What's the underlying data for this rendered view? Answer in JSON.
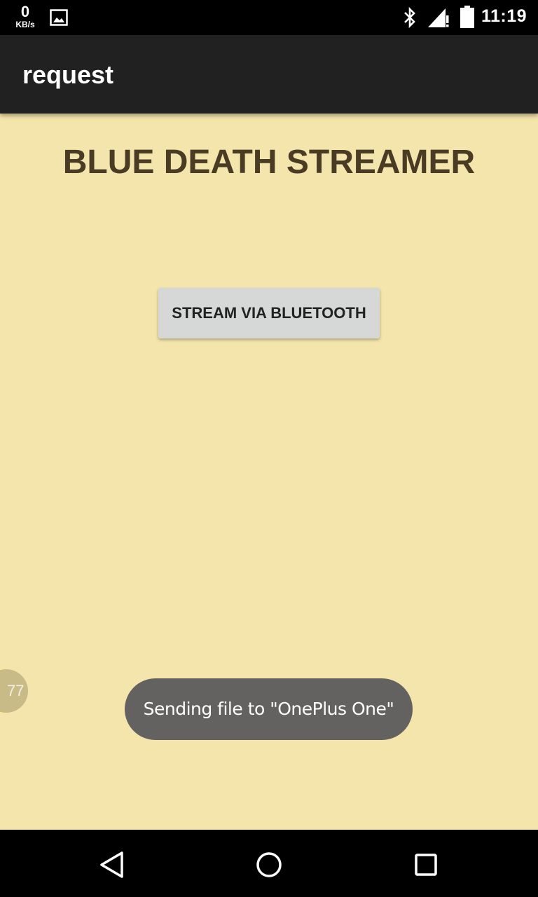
{
  "status_bar": {
    "net_speed_value": "0",
    "net_speed_unit": "KB/s",
    "time": "11:19",
    "icons": [
      "gallery-icon",
      "bluetooth-icon",
      "signal-icon",
      "battery-icon"
    ]
  },
  "app_bar": {
    "title": "request"
  },
  "main": {
    "heading": "BLUE DEATH STREAMER",
    "stream_button_label": "STREAM VIA BLUETOOTH",
    "side_bubble_text": "77",
    "toast_message": "Sending file to \"OnePlus One\""
  },
  "colors": {
    "background": "#f3e5ab",
    "app_bar": "#212121",
    "heading": "#4a3c24",
    "button": "#d6d7d7",
    "toast": "#636260",
    "bubble_accent": "#f2b705"
  },
  "nav_bar": {
    "icons": [
      "back-icon",
      "home-icon",
      "recents-icon"
    ]
  }
}
